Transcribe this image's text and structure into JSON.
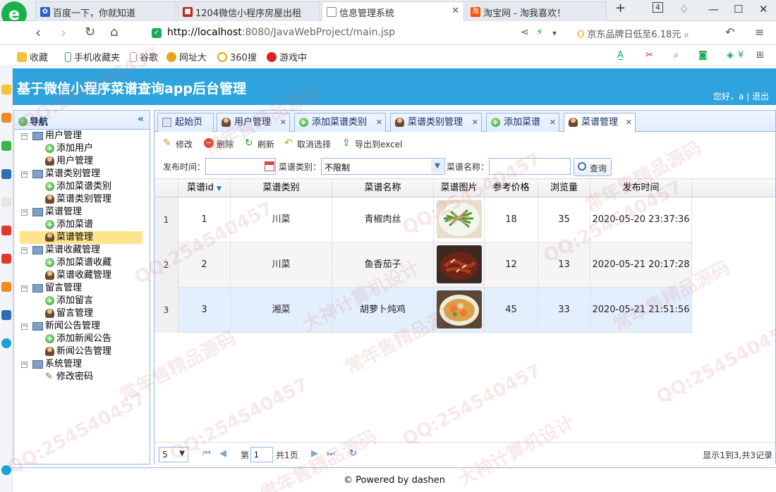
{
  "browser": {
    "tabs": [
      {
        "title": "百度一下，你就知道"
      },
      {
        "title": "1204微信小程序房屋出租"
      },
      {
        "title": "信息管理系统"
      },
      {
        "title": "淘宝网 - 淘我喜欢！"
      }
    ],
    "tab_count": "4",
    "url_host": "http://localhost",
    "url_rest": ":8080/JavaWebProject/main.jsp",
    "search_hint": "京东品牌日低至6.18元",
    "bookmarks": [
      "收藏",
      "手机收藏夹",
      "谷歌",
      "网址大",
      "360搜",
      "游戏中"
    ]
  },
  "app": {
    "title": "基于微信小程序菜谱查询app后台管理",
    "greeting": "您好，a",
    "logout": "退出",
    "footer": "© Powered by dashen"
  },
  "nav": {
    "title": "导航",
    "groups": [
      {
        "label": "用户管理",
        "items": [
          "添加用户",
          "用户管理"
        ]
      },
      {
        "label": "菜谱类别管理",
        "items": [
          "添加菜谱类别",
          "菜谱类别管理"
        ]
      },
      {
        "label": "菜谱管理",
        "items": [
          "添加菜谱",
          "菜谱管理"
        ]
      },
      {
        "label": "菜谱收藏管理",
        "items": [
          "添加菜谱收藏",
          "菜谱收藏管理"
        ]
      },
      {
        "label": "留言管理",
        "items": [
          "添加留言",
          "留言管理"
        ]
      },
      {
        "label": "新闻公告管理",
        "items": [
          "添加新闻公告",
          "新闻公告管理"
        ]
      },
      {
        "label": "系统管理",
        "items": [
          "修改密码"
        ]
      }
    ]
  },
  "tabs": [
    "起始页",
    "用户管理",
    "添加菜谱类别",
    "菜谱类别管理",
    "添加菜谱",
    "菜谱管理"
  ],
  "toolbar": {
    "edit": "修改",
    "delete": "删除",
    "refresh": "刷新",
    "deselect": "取消选择",
    "export": "导出到excel"
  },
  "search": {
    "date_label": "发布时间：",
    "category_label": "菜谱类别：",
    "category_value": "不限制",
    "name_label": "菜谱名称：",
    "query": "查询"
  },
  "grid": {
    "columns": [
      "菜谱id",
      "菜谱类别",
      "菜谱名称",
      "菜谱图片",
      "参考价格",
      "浏览量",
      "发布时间"
    ],
    "rows": [
      {
        "rn": "1",
        "id": "1",
        "category": "川菜",
        "name": "青椒肉丝",
        "price": "18",
        "views": "35",
        "time": "2020-05-20 23:37:36"
      },
      {
        "rn": "2",
        "id": "2",
        "category": "川菜",
        "name": "鱼香茄子",
        "price": "12",
        "views": "13",
        "time": "2020-05-21 20:17:28"
      },
      {
        "rn": "3",
        "id": "3",
        "category": "湘菜",
        "name": "胡萝卜炖鸡",
        "price": "45",
        "views": "33",
        "time": "2020-05-21 21:51:56"
      }
    ]
  },
  "pager": {
    "page_size": "5",
    "page_prefix": "第",
    "page": "1",
    "total_pages": "共1页",
    "info": "显示1到3,共3记录"
  },
  "watermarks": [
    "QQ:254540457",
    "常年售精品源码",
    "大神计算机设计"
  ]
}
